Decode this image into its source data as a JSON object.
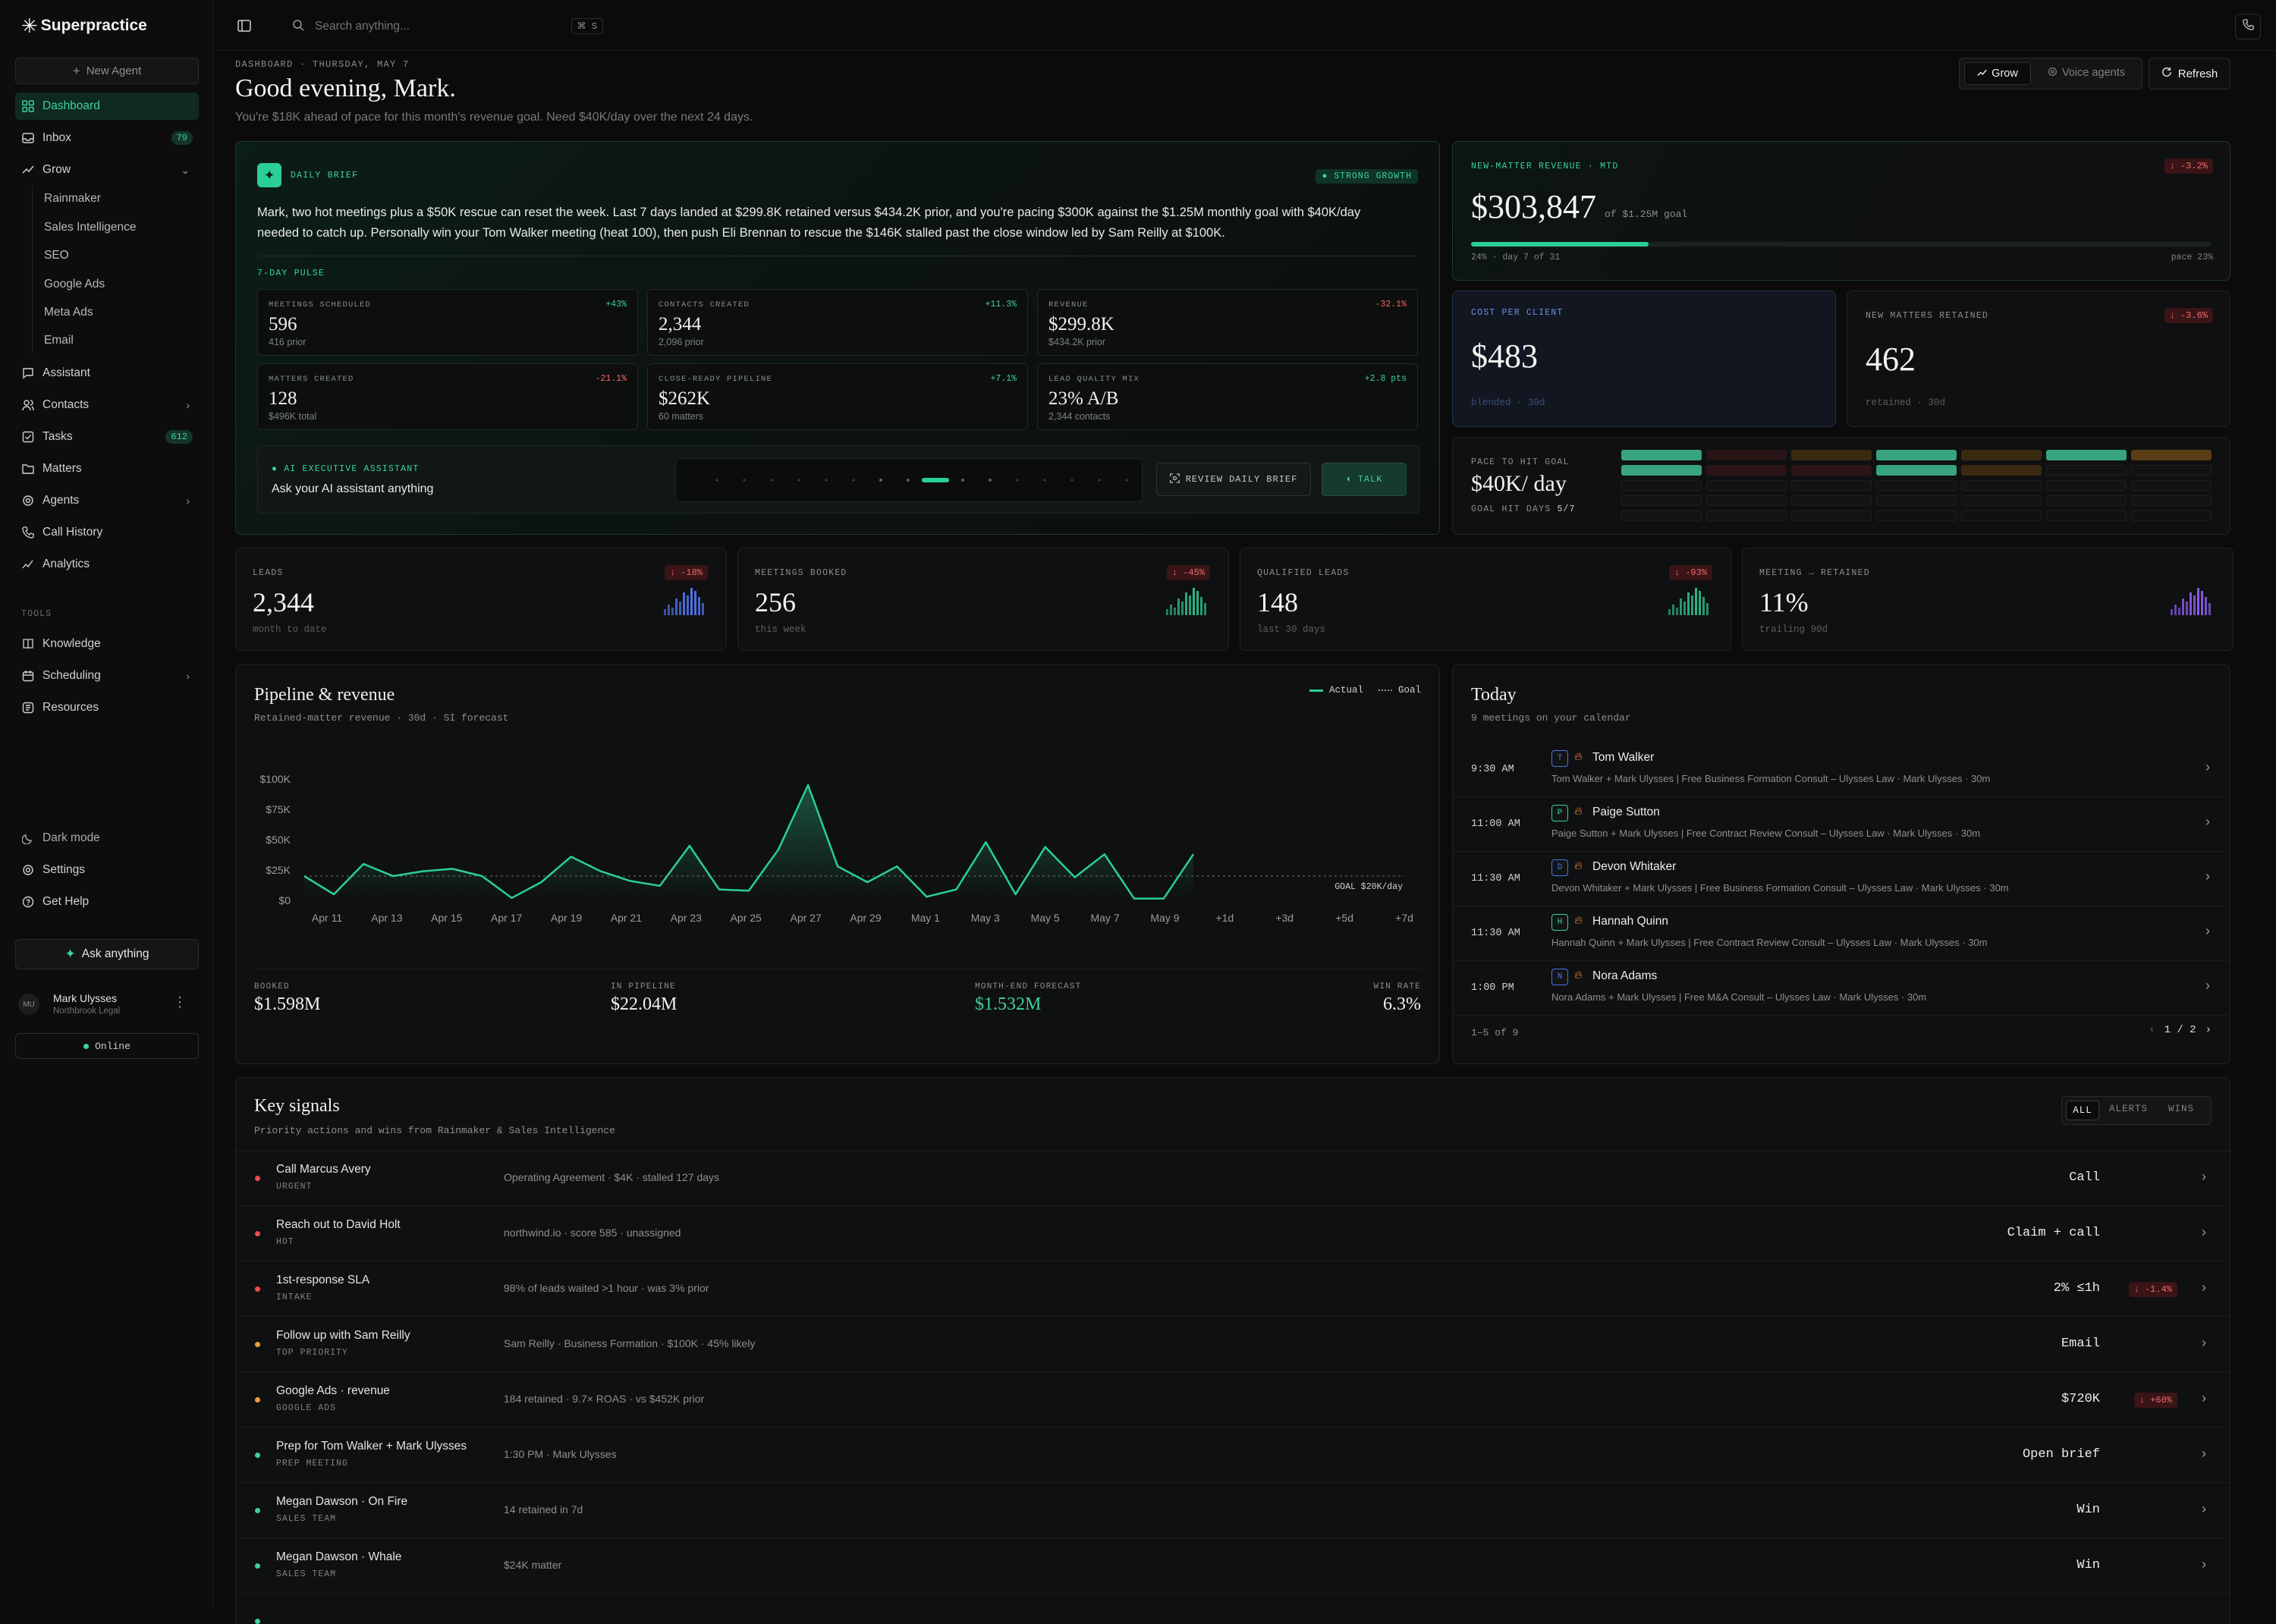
{
  "app": {
    "name": "Superpractice"
  },
  "sidebar": {
    "new_agent": "New Agent",
    "items": {
      "dashboard": "Dashboard",
      "inbox": "Inbox",
      "inbox_badge": "79",
      "grow": "Grow",
      "assistant": "Assistant",
      "contacts": "Contacts",
      "tasks": "Tasks",
      "tasks_badge": "612",
      "matters": "Matters",
      "agents": "Agents",
      "call_history": "Call History",
      "analytics": "Analytics"
    },
    "grow_sub": [
      "Rainmaker",
      "Sales Intelligence",
      "SEO",
      "Google Ads",
      "Meta Ads",
      "Email"
    ],
    "tools_heading": "TOOLS",
    "tools": {
      "knowledge": "Knowledge",
      "scheduling": "Scheduling",
      "resources": "Resources"
    },
    "bottom": {
      "dark_mode": "Dark mode",
      "settings": "Settings",
      "help": "Get Help"
    },
    "ask_anything": "Ask anything",
    "user": {
      "initials": "MU",
      "name": "Mark Ulysses",
      "org": "Northbrook Legal"
    },
    "status": "Online"
  },
  "topbar": {
    "search_placeholder": "Search anything...",
    "shortcut": "⌘ S"
  },
  "header": {
    "breadcrumb": "DASHBOARD · THURSDAY, MAY 7",
    "greeting": "Good evening, Mark.",
    "subtitle": "You're $18K ahead of pace for this month's revenue goal. Need $40K/day over the next 24 days.",
    "toggle_grow": "Grow",
    "toggle_voice": "Voice agents",
    "refresh": "Refresh"
  },
  "brief": {
    "label": "DAILY BRIEF",
    "badge": "STRONG GROWTH",
    "text": "Mark, two hot meetings plus a $50K rescue can reset the week. Last 7 days landed at $299.8K retained versus $434.2K prior, and you're pacing $300K against the $1.25M monthly goal with $40K/day needed to catch up. Personally win your Tom Walker meeting (heat 100), then push Eli Brennan to rescue the $146K stalled past the close window led by Sam Reilly at $100K.",
    "pulse_label": "7-DAY PULSE",
    "stats": [
      {
        "label": "MEETINGS SCHEDULED",
        "delta": "+43%",
        "value": "596",
        "sub": "416 prior"
      },
      {
        "label": "CONTACTS CREATED",
        "delta": "+11.3%",
        "value": "2,344",
        "sub": "2,096 prior"
      },
      {
        "label": "REVENUE",
        "delta": "-32.1%",
        "value": "$299.8K",
        "sub": "$434.2K prior"
      },
      {
        "label": "MATTERS CREATED",
        "delta": "-21.1%",
        "value": "128",
        "sub": "$496K total"
      },
      {
        "label": "CLOSE-READY PIPELINE",
        "delta": "+7.1%",
        "value": "$262K",
        "sub": "60 matters"
      },
      {
        "label": "LEAD QUALITY MIX",
        "delta": "+2.8 pts",
        "value": "23% A/B",
        "sub": "2,344 contacts"
      }
    ],
    "assistant_label": "AI EXECUTIVE ASSISTANT",
    "assistant_prompt": "Ask your AI assistant anything",
    "review_button": "REVIEW DAILY BRIEF",
    "talk_button": "TALK"
  },
  "revenue_card": {
    "label": "NEW-MATTER REVENUE · MTD",
    "delta": "↓ -3.2%",
    "value": "$303,847",
    "goal": "of $1.25M goal",
    "progress_pct": 24,
    "progress_left": "24% · day 7 of 31",
    "progress_right": "pace 23%"
  },
  "cpc_card": {
    "label": "COST PER CLIENT",
    "value": "$483",
    "sub": "blended · 30d"
  },
  "retained_card": {
    "label": "NEW MATTERS RETAINED",
    "delta": "↓ -3.6%",
    "value": "462",
    "sub": "retained · 30d"
  },
  "pace_card": {
    "label": "PACE TO HIT GOAL",
    "value": "$40K/ day",
    "sub_label": "GOAL HIT DAYS",
    "sub_value": "5/7"
  },
  "kpis": [
    {
      "label": "LEADS",
      "delta": "↓ -18%",
      "value": "2,344",
      "sub": "month to date",
      "color": "#4f74e8"
    },
    {
      "label": "MEETINGS BOOKED",
      "delta": "↓ -45%",
      "value": "256",
      "sub": "this week",
      "color": "#2bb58a"
    },
    {
      "label": "QUALIFIED LEADS",
      "delta": "↓ -93%",
      "value": "148",
      "sub": "last 30 days",
      "color": "#2bb58a"
    },
    {
      "label": "MEETING → RETAINED",
      "delta": "",
      "value": "11%",
      "sub": "trailing 90d",
      "color": "#8a5ce8"
    }
  ],
  "pipeline": {
    "title": "Pipeline & revenue",
    "subtitle": "Retained-matter revenue · 30d · SI forecast",
    "legend_actual": "Actual",
    "legend_goal": "Goal",
    "goal_label": "GOAL $20K/day",
    "footer": [
      {
        "label": "BOOKED",
        "value": "$1.598M"
      },
      {
        "label": "IN PIPELINE",
        "value": "$22.04M"
      },
      {
        "label": "MONTH-END FORECAST",
        "value": "$1.532M"
      },
      {
        "label": "WIN RATE",
        "value": "6.3%"
      }
    ]
  },
  "chart_data": {
    "type": "area",
    "title": "Pipeline & revenue",
    "subtitle": "Retained-matter revenue · 30d · SI forecast",
    "y_ticks": [
      "$100K",
      "$75K",
      "$50K",
      "$25K",
      "$0"
    ],
    "ylim": [
      0,
      100000
    ],
    "x_ticks": [
      "Apr 11",
      "Apr 13",
      "Apr 15",
      "Apr 17",
      "Apr 19",
      "Apr 21",
      "Apr 23",
      "Apr 25",
      "Apr 27",
      "Apr 29",
      "May 1",
      "May 3",
      "May 5",
      "May 7",
      "May 9",
      "+1d",
      "+3d",
      "+5d",
      "+7d"
    ],
    "series": [
      {
        "name": "Actual",
        "values": [
          20000,
          5000,
          30000,
          20000,
          24000,
          26000,
          20000,
          2000,
          15000,
          36000,
          24000,
          16000,
          12000,
          45000,
          9000,
          8000,
          42000,
          95000,
          28000,
          15000,
          28000,
          3000,
          9000,
          48000,
          5000,
          44000,
          19000,
          38000,
          1500,
          1500,
          38000
        ]
      },
      {
        "name": "Goal",
        "values": [
          20000,
          20000
        ]
      }
    ],
    "grid": false,
    "legend": "top-right"
  },
  "today": {
    "title": "Today",
    "subtitle": "9 meetings on your calendar",
    "meetings": [
      {
        "time": "9:30 AM",
        "initial": "T",
        "name": "Tom Walker",
        "detail": "Tom Walker + Mark Ulysses | Free Business Formation Consult – Ulysses Law · Mark Ulysses · 30m",
        "color": "#4f74e8"
      },
      {
        "time": "11:00 AM",
        "initial": "P",
        "name": "Paige Sutton",
        "detail": "Paige Sutton + Mark Ulysses | Free Contract Review Consult – Ulysses Law · Mark Ulysses · 30m",
        "color": "#3dd29a"
      },
      {
        "time": "11:30 AM",
        "initial": "D",
        "name": "Devon Whitaker",
        "detail": "Devon Whitaker + Mark Ulysses | Free Business Formation Consult – Ulysses Law · Mark Ulysses · 30m",
        "color": "#4f74e8"
      },
      {
        "time": "11:30 AM",
        "initial": "H",
        "name": "Hannah Quinn",
        "detail": "Hannah Quinn + Mark Ulysses | Free Contract Review Consult – Ulysses Law · Mark Ulysses · 30m",
        "color": "#3dd29a"
      },
      {
        "time": "1:00 PM",
        "initial": "N",
        "name": "Nora Adams",
        "detail": "Nora Adams + Mark Ulysses | Free M&A Consult – Ulysses Law · Mark Ulysses · 30m",
        "color": "#4f74e8"
      }
    ],
    "range": "1–5 of 9",
    "page": "1 / 2"
  },
  "signals": {
    "title": "Key signals",
    "subtitle": "Priority actions and wins from Rainmaker & Sales Intelligence",
    "filters": [
      "ALL",
      "ALERTS",
      "WINS"
    ],
    "rows": [
      {
        "title": "Call Marcus Avery",
        "tag": "URGENT",
        "detail": "Operating Agreement · $4K · stalled 127 days",
        "action": "Call",
        "pill": "",
        "dot": "#ef4b4b"
      },
      {
        "title": "Reach out to David Holt",
        "tag": "HOT",
        "detail": "northwind.io · score 585 · unassigned",
        "action": "Claim + call",
        "pill": "",
        "dot": "#ef4b4b"
      },
      {
        "title": "1st-response SLA",
        "tag": "INTAKE",
        "detail": "98% of leads waited >1 hour · was 3% prior",
        "action": "2% ≤1h",
        "pill": "↓ -1.4%",
        "dot": "#ef4b4b"
      },
      {
        "title": "Follow up with Sam Reilly",
        "tag": "TOP PRIORITY",
        "detail": "Sam Reilly · Business Formation · $100K · 45% likely",
        "action": "Email",
        "pill": "",
        "dot": "#e8a13a"
      },
      {
        "title": "Google Ads · revenue",
        "tag": "GOOGLE ADS",
        "detail": "184 retained · 9.7× ROAS · vs $452K prior",
        "action": "$720K",
        "pill": "↓ +60%",
        "dot": "#e8a13a"
      },
      {
        "title": "Prep for Tom Walker + Mark Ulysses",
        "tag": "PREP MEETING",
        "detail": "1:30 PM · Mark Ulysses",
        "action": "Open brief",
        "pill": "",
        "dot": "#3dd29a"
      },
      {
        "title": "Megan Dawson · On Fire",
        "tag": "SALES TEAM",
        "detail": "14 retained in 7d",
        "action": "Win",
        "pill": "",
        "dot": "#3dd29a"
      },
      {
        "title": "Megan Dawson · Whale",
        "tag": "SALES TEAM",
        "detail": "$24K matter",
        "action": "Win",
        "pill": "",
        "dot": "#3dd29a"
      }
    ]
  }
}
